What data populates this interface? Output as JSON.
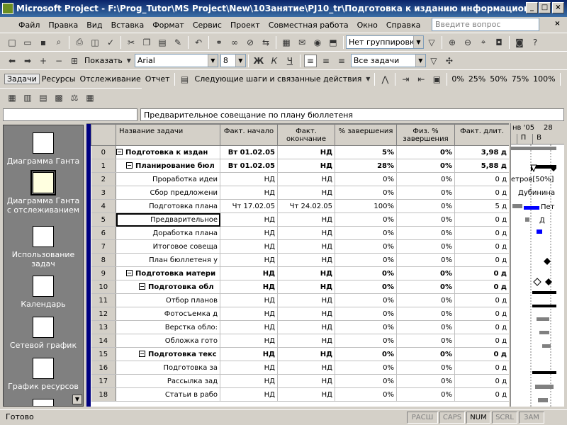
{
  "window": {
    "title": "Microsoft Project - F:\\Prog_Tutor\\MS Project\\New\\10Занятие\\PJ10_tr\\Подготовка к изданию информационного бюллете..."
  },
  "menu": [
    "Файл",
    "Правка",
    "Вид",
    "Вставка",
    "Формат",
    "Сервис",
    "Проект",
    "Совместная работа",
    "Окно",
    "Справка"
  ],
  "ask_box": {
    "placeholder": "Введите вопрос"
  },
  "toolbar1": {
    "group_by": "Нет группировки"
  },
  "toolbar2": {
    "show_label": "Показать",
    "font": "Arial",
    "size": "8",
    "filter": "Все задачи"
  },
  "toolbar3": {
    "tabs": [
      "Задачи",
      "Ресурсы",
      "Отслеживание",
      "Отчет"
    ],
    "next_steps": "Следующие шаги и связанные действия",
    "percents": [
      "0%",
      "25%",
      "50%",
      "75%",
      "100%"
    ]
  },
  "entry_bar": {
    "value": "Предварительное совещание по плану бюллетеня"
  },
  "view_bar": [
    {
      "label": "Диаграмма Ганта"
    },
    {
      "label": "Диаграмма Ганта с отслеживанием"
    },
    {
      "label": "Использование задач"
    },
    {
      "label": "Календарь"
    },
    {
      "label": "Сетевой график"
    },
    {
      "label": "График ресурсов"
    }
  ],
  "table": {
    "headers": [
      "Название задачи",
      "Факт. начало",
      "Факт. окончание",
      "% завершения",
      "Физ. % завершения",
      "Факт. длит."
    ],
    "rows": [
      {
        "id": "0",
        "name": "Подготовка к издан",
        "start": "Вт 01.02.05",
        "finish": "НД",
        "pct": "5%",
        "phys": "0%",
        "dur": "3,98 д"
      },
      {
        "id": "1",
        "name": "Планирование бюл",
        "start": "Вт 01.02.05",
        "finish": "НД",
        "pct": "28%",
        "phys": "0%",
        "dur": "5,88 д"
      },
      {
        "id": "2",
        "name": "Проработка идеи",
        "start": "НД",
        "finish": "НД",
        "pct": "0%",
        "phys": "0%",
        "dur": "0 д"
      },
      {
        "id": "3",
        "name": "Сбор предложени",
        "start": "НД",
        "finish": "НД",
        "pct": "0%",
        "phys": "0%",
        "dur": "0 д"
      },
      {
        "id": "4",
        "name": "Подготовка плана",
        "start": "Чт 17.02.05",
        "finish": "Чт 24.02.05",
        "pct": "100%",
        "phys": "0%",
        "dur": "5 д"
      },
      {
        "id": "5",
        "name": "Предварительное",
        "start": "НД",
        "finish": "НД",
        "pct": "0%",
        "phys": "0%",
        "dur": "0 д"
      },
      {
        "id": "6",
        "name": "Доработка плана",
        "start": "НД",
        "finish": "НД",
        "pct": "0%",
        "phys": "0%",
        "dur": "0 д"
      },
      {
        "id": "7",
        "name": "Итоговое совеща",
        "start": "НД",
        "finish": "НД",
        "pct": "0%",
        "phys": "0%",
        "dur": "0 д"
      },
      {
        "id": "8",
        "name": "План бюллетеня у",
        "start": "НД",
        "finish": "НД",
        "pct": "0%",
        "phys": "0%",
        "dur": "0 д"
      },
      {
        "id": "9",
        "name": "Подготовка матери",
        "start": "НД",
        "finish": "НД",
        "pct": "0%",
        "phys": "0%",
        "dur": "0 д"
      },
      {
        "id": "10",
        "name": "Подготовка обл",
        "start": "НД",
        "finish": "НД",
        "pct": "0%",
        "phys": "0%",
        "dur": "0 д"
      },
      {
        "id": "11",
        "name": "Отбор планов",
        "start": "НД",
        "finish": "НД",
        "pct": "0%",
        "phys": "0%",
        "dur": "0 д"
      },
      {
        "id": "12",
        "name": "Фотосъемка д",
        "start": "НД",
        "finish": "НД",
        "pct": "0%",
        "phys": "0%",
        "dur": "0 д"
      },
      {
        "id": "13",
        "name": "Верстка обло:",
        "start": "НД",
        "finish": "НД",
        "pct": "0%",
        "phys": "0%",
        "dur": "0 д"
      },
      {
        "id": "14",
        "name": "Обложка гото",
        "start": "НД",
        "finish": "НД",
        "pct": "0%",
        "phys": "0%",
        "dur": "0 д"
      },
      {
        "id": "15",
        "name": "Подготовка текс",
        "start": "НД",
        "finish": "НД",
        "pct": "0%",
        "phys": "0%",
        "dur": "0 д"
      },
      {
        "id": "16",
        "name": "Подготовка за",
        "start": "НД",
        "finish": "НД",
        "pct": "0%",
        "phys": "0%",
        "dur": "0 д"
      },
      {
        "id": "17",
        "name": "Рассылка зад",
        "start": "НД",
        "finish": "НД",
        "pct": "0%",
        "phys": "0%",
        "dur": "0 д"
      },
      {
        "id": "18",
        "name": "Статьи в рабо",
        "start": "НД",
        "finish": "НД",
        "pct": "0%",
        "phys": "0%",
        "dur": "0 д"
      }
    ]
  },
  "gantt": {
    "header_top": [
      "нв '05",
      "28"
    ],
    "header_days": [
      "П",
      "В"
    ],
    "labels": [
      "етров[50%]",
      "Дубинина",
      "Пет",
      "Д"
    ]
  },
  "status": {
    "text": "Готово",
    "indicators": [
      "РАСШ",
      "CAPS",
      "NUM",
      "SCRL",
      "ЗАМ"
    ]
  },
  "colors": {
    "title_bg": "#0a246a",
    "progress": "#0000ff",
    "chrome": "#d4d0c8"
  }
}
